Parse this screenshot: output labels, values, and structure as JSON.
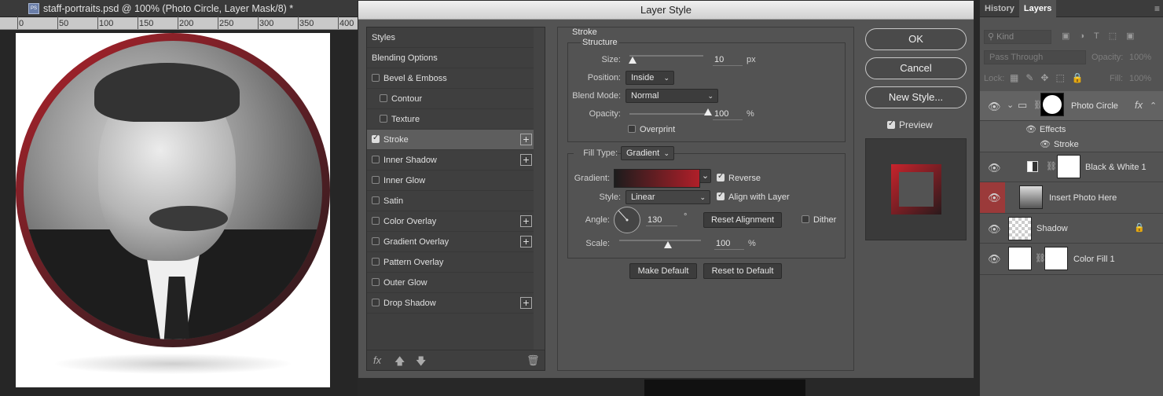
{
  "document": {
    "tab_title": "staff-portraits.psd @ 100% (Photo Circle, Layer Mask/8) *",
    "ruler_ticks": [
      "0",
      "50",
      "100",
      "150",
      "200",
      "250",
      "300",
      "350",
      "400"
    ]
  },
  "dialog": {
    "title": "Layer Style",
    "styles_list": [
      {
        "label": "Styles",
        "checkbox": false,
        "checked": false,
        "plus": false,
        "indent": false,
        "selected": false
      },
      {
        "label": "Blending Options",
        "checkbox": false,
        "checked": false,
        "plus": false,
        "indent": false,
        "selected": false
      },
      {
        "label": "Bevel & Emboss",
        "checkbox": true,
        "checked": false,
        "plus": false,
        "indent": false,
        "selected": false
      },
      {
        "label": "Contour",
        "checkbox": true,
        "checked": false,
        "plus": false,
        "indent": true,
        "selected": false
      },
      {
        "label": "Texture",
        "checkbox": true,
        "checked": false,
        "plus": false,
        "indent": true,
        "selected": false
      },
      {
        "label": "Stroke",
        "checkbox": true,
        "checked": true,
        "plus": true,
        "indent": false,
        "selected": true
      },
      {
        "label": "Inner Shadow",
        "checkbox": true,
        "checked": false,
        "plus": true,
        "indent": false,
        "selected": false
      },
      {
        "label": "Inner Glow",
        "checkbox": true,
        "checked": false,
        "plus": false,
        "indent": false,
        "selected": false
      },
      {
        "label": "Satin",
        "checkbox": true,
        "checked": false,
        "plus": false,
        "indent": false,
        "selected": false
      },
      {
        "label": "Color Overlay",
        "checkbox": true,
        "checked": false,
        "plus": true,
        "indent": false,
        "selected": false
      },
      {
        "label": "Gradient Overlay",
        "checkbox": true,
        "checked": false,
        "plus": true,
        "indent": false,
        "selected": false
      },
      {
        "label": "Pattern Overlay",
        "checkbox": true,
        "checked": false,
        "plus": false,
        "indent": false,
        "selected": false
      },
      {
        "label": "Outer Glow",
        "checkbox": true,
        "checked": false,
        "plus": false,
        "indent": false,
        "selected": false
      },
      {
        "label": "Drop Shadow",
        "checkbox": true,
        "checked": false,
        "plus": true,
        "indent": false,
        "selected": false
      }
    ],
    "footer": {
      "fx": "fx",
      "up": "🡅",
      "down": "🡇",
      "trash": "🗑"
    },
    "stroke": {
      "section_title": "Stroke",
      "structure_title": "Structure",
      "size_label": "Size:",
      "size_value": "10",
      "size_unit": "px",
      "size_fraction": 0.04,
      "position_label": "Position:",
      "position_value": "Inside",
      "blend_label": "Blend Mode:",
      "blend_value": "Normal",
      "opacity_label": "Opacity:",
      "opacity_value": "100",
      "opacity_unit": "%",
      "opacity_fraction": 1.0,
      "overprint_label": "Overprint",
      "filltype_label": "Fill Type:",
      "filltype_value": "Gradient",
      "gradient_label": "Gradient:",
      "reverse_label": "Reverse",
      "style_label": "Style:",
      "style_value": "Linear",
      "align_label": "Align with Layer",
      "angle_label": "Angle:",
      "angle_value": "130",
      "angle_unit": "°",
      "reset_alignment_label": "Reset Alignment",
      "dither_label": "Dither",
      "scale_label": "Scale:",
      "scale_value": "100",
      "scale_unit": "%",
      "scale_fraction": 0.6,
      "make_default_label": "Make Default",
      "reset_default_label": "Reset to Default"
    },
    "buttons": {
      "ok": "OK",
      "cancel": "Cancel",
      "new_style": "New Style...",
      "preview": "Preview"
    }
  },
  "layers_panel": {
    "tabs": [
      "History",
      "Layers"
    ],
    "kind_label": "Kind",
    "blend_value": "Pass Through",
    "opacity_label": "Opacity:",
    "opacity_value": "100%",
    "lock_label": "Lock:",
    "fill_label": "Fill:",
    "fill_value": "100%",
    "layers": [
      {
        "name": "Photo Circle"
      },
      {
        "name": "Effects"
      },
      {
        "name": "Stroke"
      },
      {
        "name": "Black & White 1"
      },
      {
        "name": "Insert Photo Here"
      },
      {
        "name": "Shadow"
      },
      {
        "name": "Color Fill 1"
      }
    ]
  },
  "colors": {
    "accent_red": "#b01f29",
    "panel": "#535353"
  }
}
